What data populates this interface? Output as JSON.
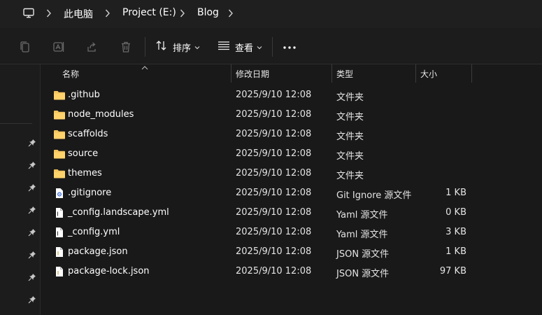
{
  "breadcrumb": {
    "items": [
      "此电脑",
      "Project (E:)",
      "Blog"
    ]
  },
  "toolbar": {
    "sort_label": "排序",
    "view_label": "查看",
    "more_label": "..."
  },
  "columns": {
    "name": "名称",
    "modified": "修改日期",
    "type": "类型",
    "size": "大小"
  },
  "files": [
    {
      "name": ".github",
      "modified": "2025/9/10 12:08",
      "type": "文件夹",
      "size": "",
      "icon": "folder-icon"
    },
    {
      "name": "node_modules",
      "modified": "2025/9/10 12:08",
      "type": "文件夹",
      "size": "",
      "icon": "folder-icon"
    },
    {
      "name": "scaffolds",
      "modified": "2025/9/10 12:08",
      "type": "文件夹",
      "size": "",
      "icon": "folder-icon"
    },
    {
      "name": "source",
      "modified": "2025/9/10 12:08",
      "type": "文件夹",
      "size": "",
      "icon": "folder-icon"
    },
    {
      "name": "themes",
      "modified": "2025/9/10 12:08",
      "type": "文件夹",
      "size": "",
      "icon": "folder-icon"
    },
    {
      "name": ".gitignore",
      "modified": "2025/9/10 12:08",
      "type": "Git Ignore 源文件",
      "size": "1 KB",
      "icon": "gear-file-icon"
    },
    {
      "name": "_config.landscape.yml",
      "modified": "2025/9/10 12:08",
      "type": "Yaml 源文件",
      "size": "0 KB",
      "icon": "file-icon"
    },
    {
      "name": "_config.yml",
      "modified": "2025/9/10 12:08",
      "type": "Yaml 源文件",
      "size": "3 KB",
      "icon": "file-icon"
    },
    {
      "name": "package.json",
      "modified": "2025/9/10 12:08",
      "type": "JSON 源文件",
      "size": "1 KB",
      "icon": "json-file-icon"
    },
    {
      "name": "package-lock.json",
      "modified": "2025/9/10 12:08",
      "type": "JSON 源文件",
      "size": "97 KB",
      "icon": "json-file-icon"
    }
  ],
  "colors": {
    "background": "#191919",
    "folder": "#f2c55c",
    "text": "#ffffff"
  }
}
